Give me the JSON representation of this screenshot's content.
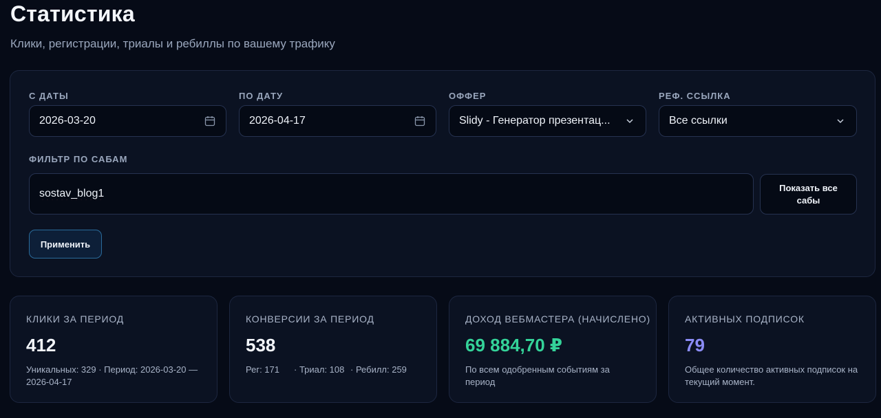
{
  "header": {
    "title": "Статистика",
    "subtitle": "Клики, регистрации, триалы и ребиллы по вашему трафику"
  },
  "filters": {
    "date_from": {
      "label": "С ДАТЫ",
      "value": "2026-03-20",
      "icon": "calendar-icon"
    },
    "date_to": {
      "label": "ПО ДАТУ",
      "value": "2026-04-17",
      "icon": "calendar-icon"
    },
    "offer": {
      "label": "ОФФЕР",
      "value": "Slidy - Генератор презентац...",
      "icon": "chevron-down-icon"
    },
    "ref_link": {
      "label": "РЕФ. ССЫЛКА",
      "value": "Все ссылки",
      "icon": "chevron-down-icon"
    },
    "subs": {
      "label": "ФИЛЬТР ПО САБАМ",
      "value": "sostav_blog1"
    },
    "show_all_label": "Показать все сабы",
    "apply_label": "Применить"
  },
  "stats": {
    "clicks": {
      "label": "КЛИКИ ЗА ПЕРИОД",
      "value": "412",
      "note": "Уникальных: 329 · Период: 2026-03-20 — 2026-04-17"
    },
    "conversions": {
      "label": "КОНВЕРСИИ ЗА ПЕРИОД",
      "value": "538",
      "reg": "Рег: 171",
      "trial": "· Триал: 108",
      "rebill": "· Ребилл: 259"
    },
    "revenue": {
      "label": "ДОХОД ВЕБМАСТЕРА (НАЧИСЛЕНО)",
      "value": "69 884,70 ₽",
      "value_color": "#34d399",
      "note": "По всем одобренным событиям за период"
    },
    "subscriptions": {
      "label": "АКТИВНЫХ ПОДПИСОК",
      "value": "79",
      "value_color": "#8b8cf6",
      "note": "Общее количество активных подписок на текущий момент."
    }
  }
}
